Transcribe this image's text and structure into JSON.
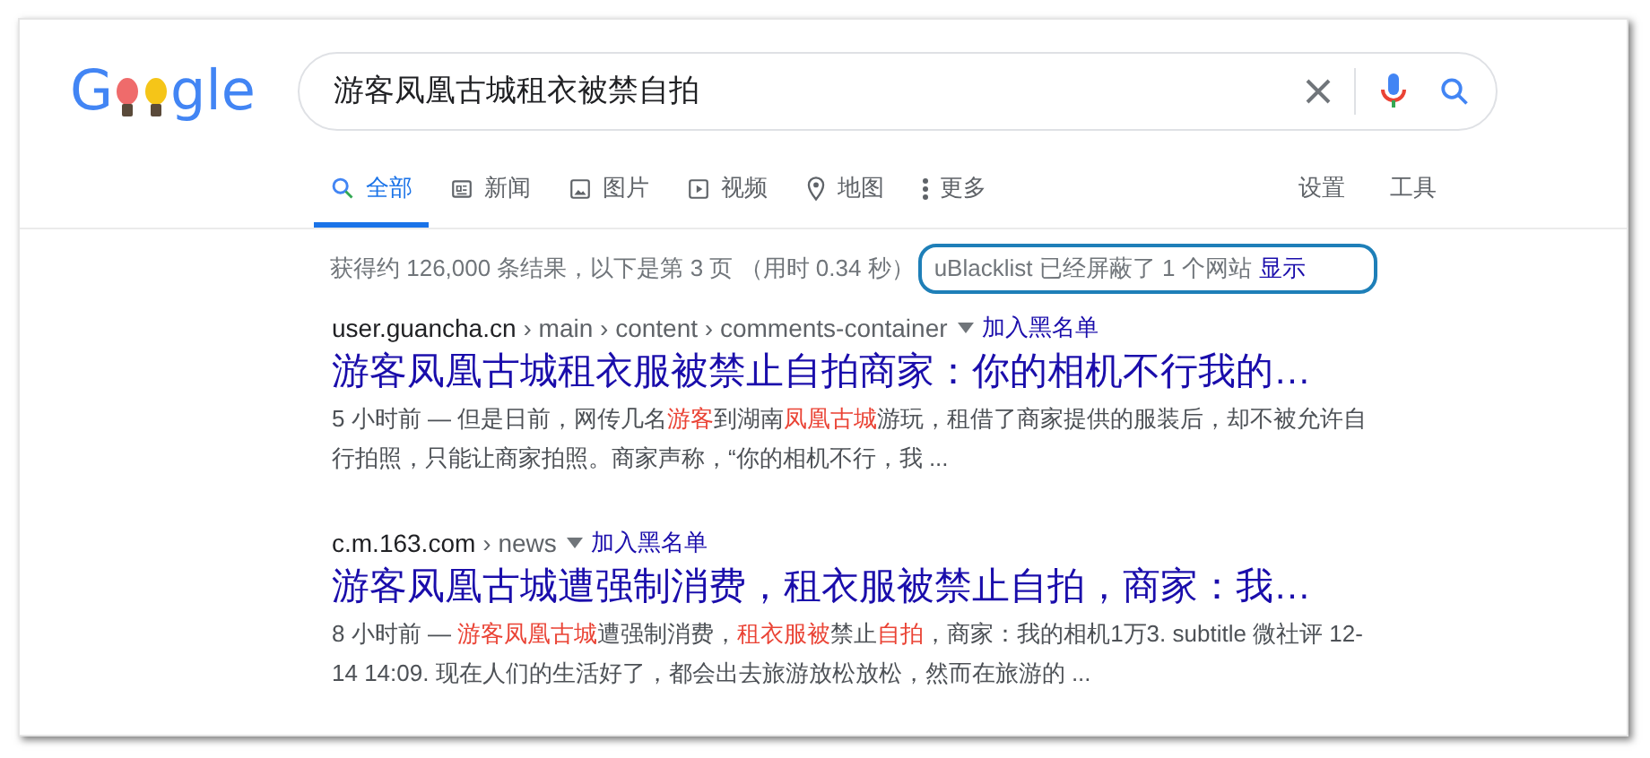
{
  "logo": {
    "left": "G",
    "right": "gle"
  },
  "search": {
    "value": "游客凤凰古城租衣被禁自拍"
  },
  "tabs": [
    {
      "kind": "all",
      "label": "全部",
      "selected": true
    },
    {
      "kind": "news",
      "label": "新闻",
      "selected": false
    },
    {
      "kind": "images",
      "label": "图片",
      "selected": false
    },
    {
      "kind": "videos",
      "label": "视频",
      "selected": false
    },
    {
      "kind": "maps",
      "label": "地图",
      "selected": false
    },
    {
      "kind": "more",
      "label": "更多",
      "selected": false
    }
  ],
  "tools": [
    "设置",
    "工具"
  ],
  "stats": "获得约 126,000 条结果，以下是第 3 页 （用时 0.34 秒）",
  "blocked": {
    "text": "uBlacklist 已经屏蔽了 1 个网站",
    "link": "显示"
  },
  "results": [
    {
      "site": "user.guancha.cn",
      "path": "› main › content › comments-container",
      "blacklist": "加入黑名单",
      "title": "游客凤凰古城租衣服被禁止自拍商家：你的相机不行我的…",
      "snippet": [
        {
          "text": "5 小时前 — 但是日前，网传几名",
          "hl": false
        },
        {
          "text": "游客",
          "hl": true
        },
        {
          "text": "到湖南",
          "hl": false
        },
        {
          "text": "凤凰古城",
          "hl": true
        },
        {
          "text": "游玩，租借了商家提供的服装后，却不被允许自行拍照，只能让商家拍照。商家声称，“你的相机不行，我 ...",
          "hl": false
        }
      ]
    },
    {
      "site": "c.m.163.com",
      "path": "› news",
      "blacklist": "加入黑名单",
      "title": "游客凤凰古城遭强制消费，租衣服被禁止自拍，商家：我…",
      "snippet": [
        {
          "text": "8 小时前 — ",
          "hl": false
        },
        {
          "text": "游客凤凰古城",
          "hl": true
        },
        {
          "text": "遭强制消费，",
          "hl": false
        },
        {
          "text": "租衣服被",
          "hl": true
        },
        {
          "text": "禁止",
          "hl": false
        },
        {
          "text": "自拍",
          "hl": true
        },
        {
          "text": "，商家：我的相机1万3. subtitle 微社评 12-14 14:09. 现在人们的生活好了，都会出去旅游放松放松，然而在旅游的 ...",
          "hl": false
        }
      ]
    }
  ]
}
